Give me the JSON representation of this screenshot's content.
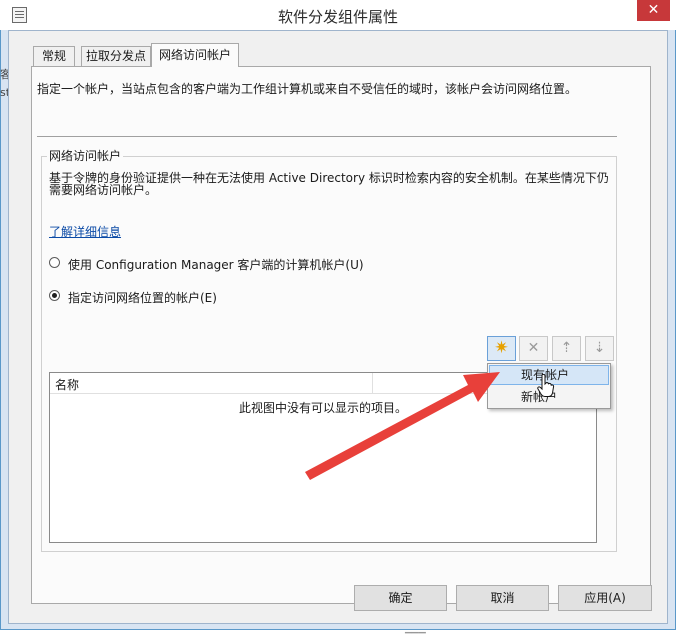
{
  "window": {
    "title": "软件分发组件属性",
    "close_glyph": "✕"
  },
  "tabs": [
    {
      "label": "常规"
    },
    {
      "label": "拉取分发点"
    },
    {
      "label": "网络访问帐户"
    }
  ],
  "description": "指定一个帐户，当站点包含的客户端为工作组计算机或来自不受信任的域时，该帐户会访问网络位置。",
  "group": {
    "label": "网络访问帐户",
    "text": "基于令牌的身份验证提供一种在无法使用 Active Directory 标识时检索内容的安全机制。在某些情况下仍需要网络访问帐户。",
    "link": "了解详细信息",
    "radio_options": [
      {
        "label": "使用 Configuration Manager 客户端的计算机帐户(U)",
        "checked": false
      },
      {
        "label": "指定访问网络位置的帐户(E)",
        "checked": true
      }
    ]
  },
  "toolbar": {
    "buttons": [
      {
        "name": "new-account-button",
        "icon": "starburst-icon",
        "glyph": "✷",
        "active": true
      },
      {
        "name": "delete-button",
        "icon": "delete-x-icon",
        "glyph": "✕",
        "active": false
      },
      {
        "name": "move-up-button",
        "icon": "move-up-icon",
        "glyph": "⇡",
        "active": false
      },
      {
        "name": "move-down-button",
        "icon": "move-down-icon",
        "glyph": "⇣",
        "active": false
      }
    ]
  },
  "list": {
    "columns": [
      "名称"
    ],
    "empty_message": "此视图中没有可以显示的项目。"
  },
  "dropdown_menu": {
    "items": [
      {
        "label": "现有帐户",
        "hover": true
      },
      {
        "label": "新帐户",
        "hover": false
      }
    ]
  },
  "buttons": {
    "ok": "确定",
    "cancel": "取消",
    "apply": "应用(A)"
  },
  "background_fragments": {
    "left_a": "客",
    "left_b": "st"
  },
  "colors": {
    "close_button": "#c7383a",
    "link": "#0b4aa6",
    "annotation_arrow": "#e8403a",
    "menu_hover": "#d5e6f7"
  }
}
